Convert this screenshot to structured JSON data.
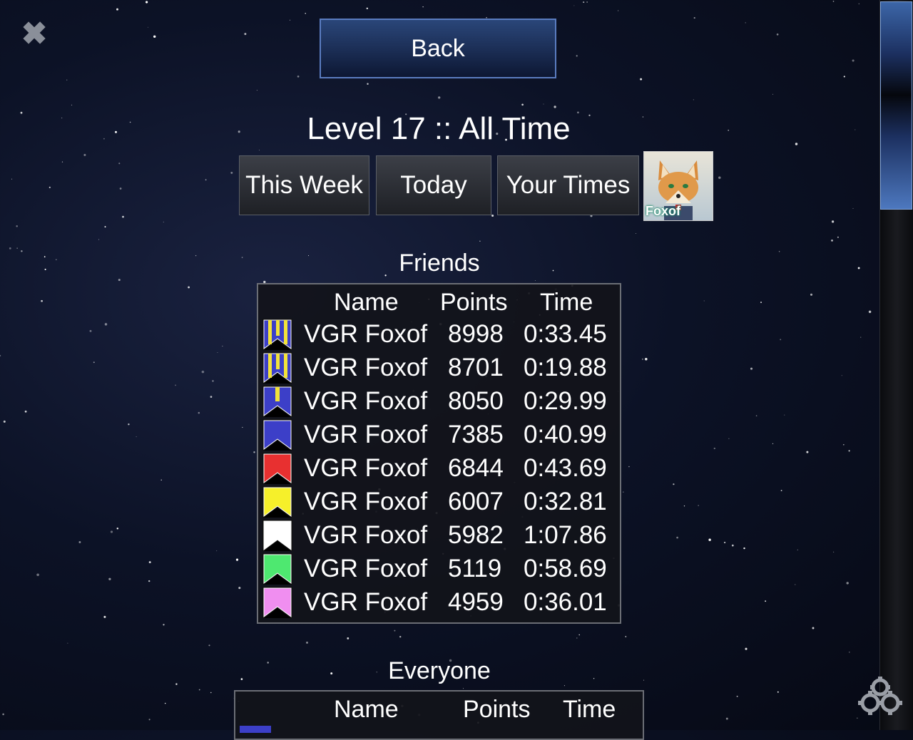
{
  "header": {
    "back_label": "Back",
    "title": "Level 17 :: All Time"
  },
  "tabs": [
    {
      "label": "This Week"
    },
    {
      "label": "Today"
    },
    {
      "label": "Your Times"
    }
  ],
  "avatar": {
    "label": "Foxof"
  },
  "friends": {
    "title": "Friends",
    "columns": [
      "Name",
      "Points",
      "Time"
    ],
    "rows": [
      {
        "badge": "gold-striped-blue",
        "name": "VGR Foxof",
        "points": "8998",
        "time": "0:33.45"
      },
      {
        "badge": "gold-striped-blue",
        "name": "VGR Foxof",
        "points": "8701",
        "time": "0:19.88"
      },
      {
        "badge": "gold-single-blue",
        "name": "VGR Foxof",
        "points": "8050",
        "time": "0:29.99"
      },
      {
        "badge": "blue",
        "name": "VGR Foxof",
        "points": "7385",
        "time": "0:40.99"
      },
      {
        "badge": "red",
        "name": "VGR Foxof",
        "points": "6844",
        "time": "0:43.69"
      },
      {
        "badge": "yellow",
        "name": "VGR Foxof",
        "points": "6007",
        "time": "0:32.81"
      },
      {
        "badge": "white",
        "name": "VGR Foxof",
        "points": "5982",
        "time": "1:07.86"
      },
      {
        "badge": "green",
        "name": "VGR Foxof",
        "points": "5119",
        "time": "0:58.69"
      },
      {
        "badge": "pink",
        "name": "VGR Foxof",
        "points": "4959",
        "time": "0:36.01"
      }
    ]
  },
  "everyone": {
    "title": "Everyone",
    "columns": [
      "Name",
      "Points",
      "Time"
    ]
  },
  "colors": {
    "badge_blue": "#3c3fc8",
    "badge_gold": "#f2e23a",
    "badge_red": "#e83030",
    "badge_yellow": "#f6f02a",
    "badge_white": "#ffffff",
    "badge_green": "#4ee870",
    "badge_pink": "#f08ef0",
    "back_button": "#1c2f57",
    "scroll_thumb": "#3c66a8"
  }
}
